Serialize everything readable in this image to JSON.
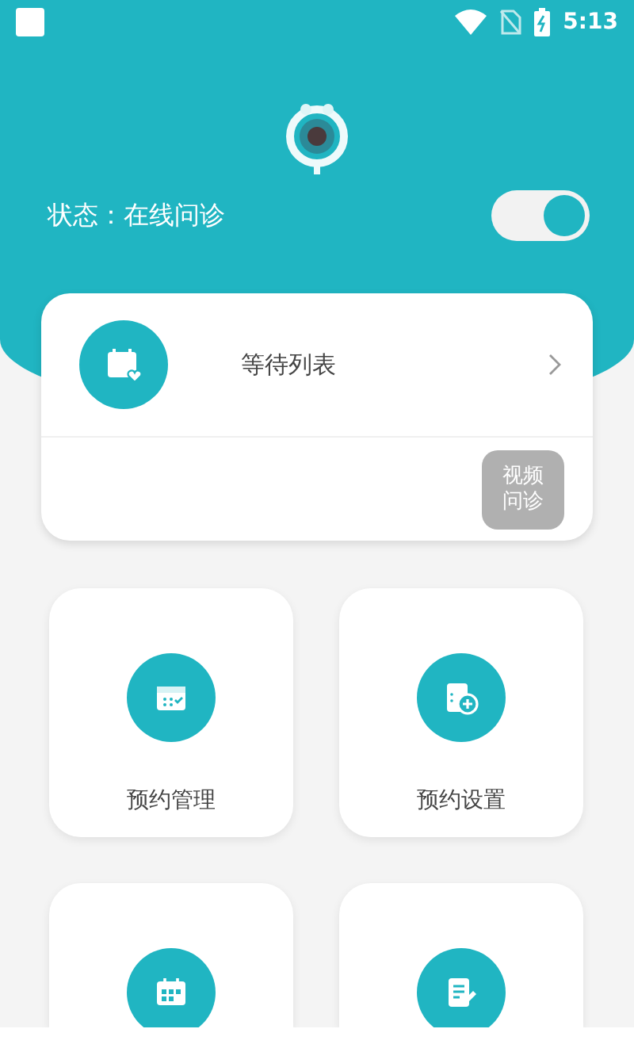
{
  "status_bar": {
    "time": "5:13"
  },
  "header": {
    "status_label": "状态：在线问诊",
    "online": true
  },
  "waiting_card": {
    "label": "等待列表",
    "video_button": "视频问诊"
  },
  "menu": [
    {
      "kind": "calendar-check",
      "label": "预约管理"
    },
    {
      "kind": "calendar-add",
      "label": "预约设置"
    },
    {
      "kind": "calendar-grid"
    },
    {
      "kind": "document-edit"
    }
  ]
}
